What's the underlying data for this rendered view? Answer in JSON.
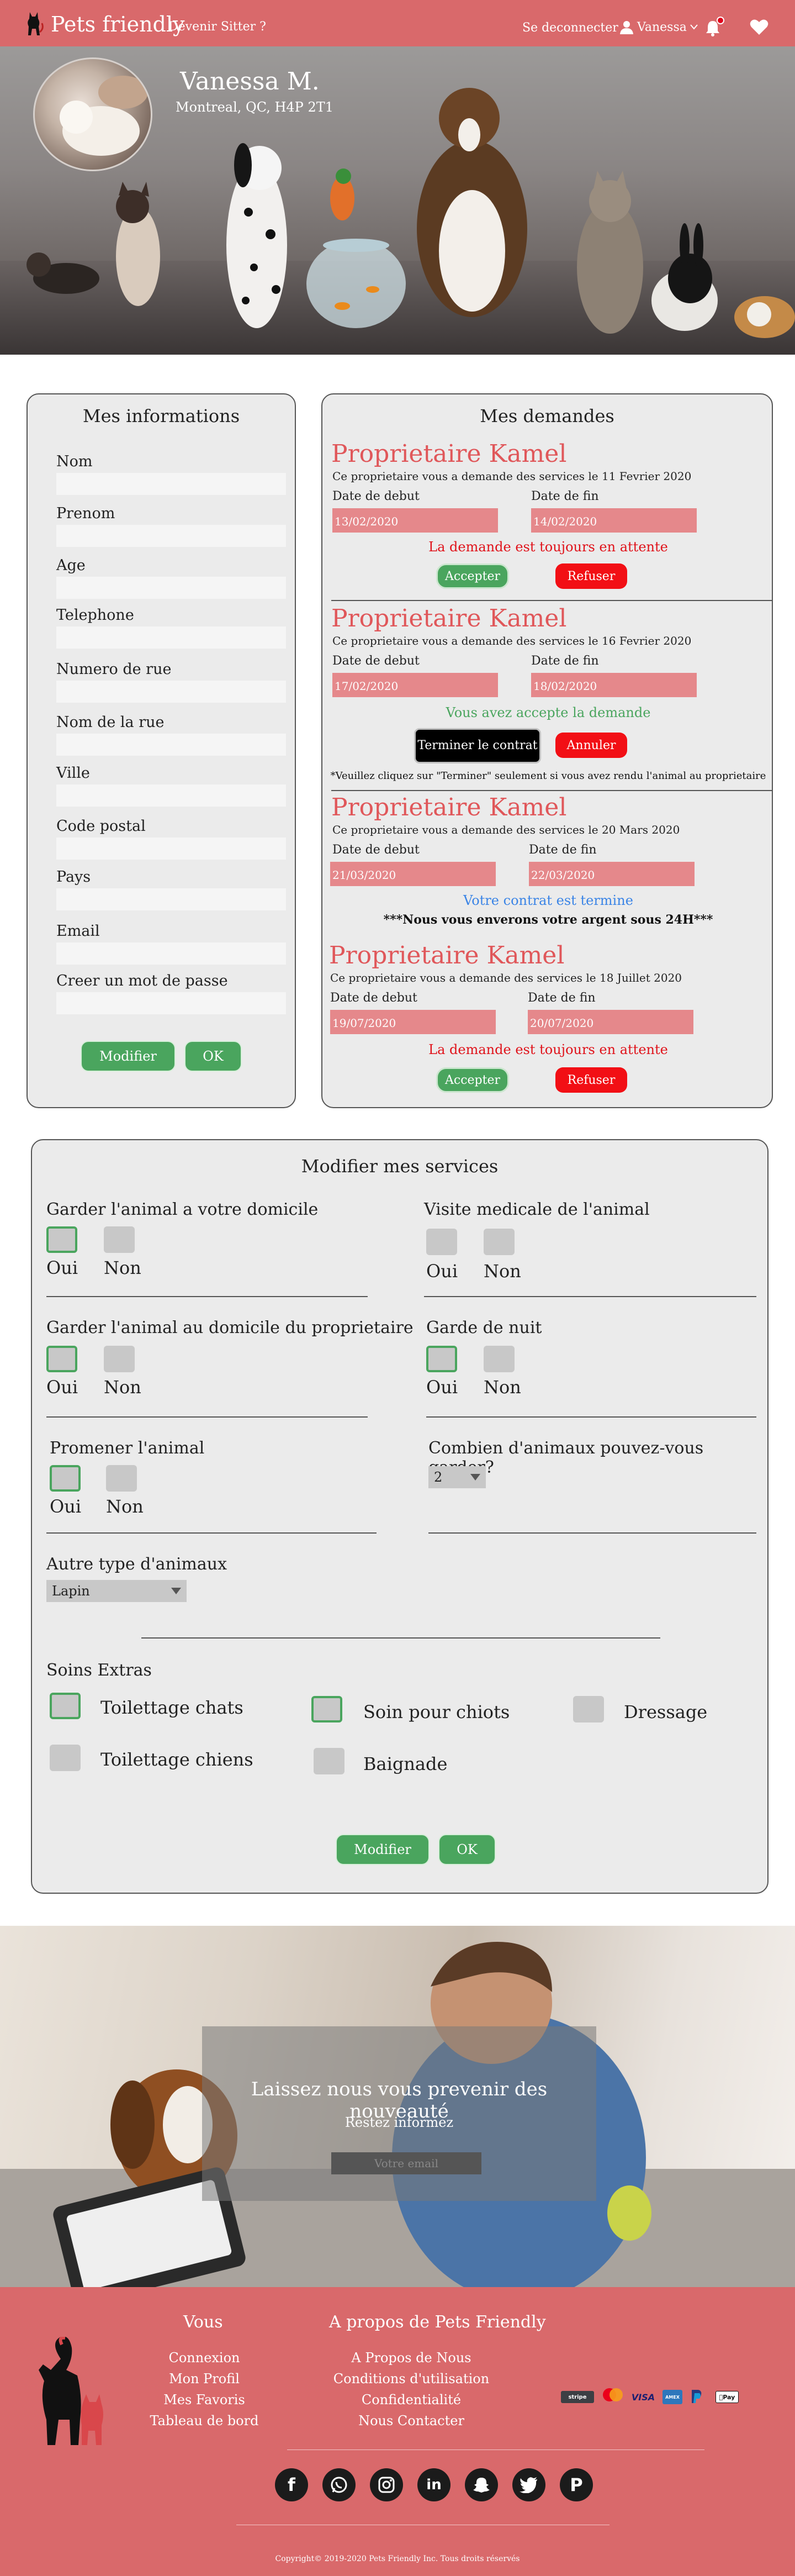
{
  "navbar": {
    "brand": "Pets friendly",
    "become_sitter": "Devenir Sitter ?",
    "logout": "Se deconnecter",
    "user": "Vanessa",
    "colors": {
      "navbar": "#d9696b"
    }
  },
  "profile": {
    "name": "Vanessa M.",
    "address": "Montreal, QC, H4P 2T1"
  },
  "info": {
    "title": "Mes informations",
    "fields": [
      "Nom",
      "Prenom",
      "Age",
      "Telephone",
      "Numero de rue",
      "Nom de la rue",
      "Ville",
      "Code postal",
      "Pays",
      "Email",
      "Creer un mot de passe"
    ],
    "modify_label": "Modifier",
    "ok_label": "OK"
  },
  "requests": {
    "title": "Mes demandes",
    "start_label": "Date de debut",
    "end_label": "Date de fin",
    "items": [
      {
        "owner": "Proprietaire Kamel",
        "text": "Ce proprietaire vous a demande des services le 11 Fevrier 2020",
        "start": "13/02/2020",
        "end": "14/02/2020",
        "status": "La demande est toujours en attente",
        "accept": "Accepter",
        "refuse": "Refuser"
      },
      {
        "owner": "Proprietaire Kamel",
        "text": "Ce proprietaire vous a demande des services le 16 Fevrier 2020",
        "start": "17/02/2020",
        "end": "18/02/2020",
        "status": "Vous avez accepte la demande",
        "finish": "Terminer le contrat",
        "cancel": "Annuler",
        "note": "*Veuillez cliquez sur \"Terminer\" seulement si vous avez rendu l'animal au proprietaire"
      },
      {
        "owner": "Proprietaire Kamel",
        "text": "Ce proprietaire vous a demande des services le 20 Mars 2020",
        "start": "21/03/2020",
        "end": "22/03/2020",
        "status": "Votre contrat est termine",
        "note": "***Nous vous enverons votre argent sous 24H***"
      },
      {
        "owner": "Proprietaire Kamel",
        "text": "Ce proprietaire vous a demande des services le 18 Juillet 2020",
        "start": "19/07/2020",
        "end": "20/07/2020",
        "status": "La demande est toujours en attente",
        "accept": "Accepter",
        "refuse": "Refuser"
      }
    ]
  },
  "services": {
    "title": "Modifier mes services",
    "oui": "Oui",
    "non": "Non",
    "home_care": {
      "label": "Garder l'animal a votre domicile",
      "oui_checked": true
    },
    "vet_visit": {
      "label": "Visite medicale de l'animal",
      "oui_checked": false
    },
    "owner_home": {
      "label": "Garder l'animal au domicile du proprietaire",
      "oui_checked": true
    },
    "night": {
      "label": "Garde de nuit",
      "oui_checked": true
    },
    "walk": {
      "label": "Promener l'animal",
      "oui_checked": true
    },
    "count": {
      "label": "Combien d'animaux pouvez-vous garder?",
      "value": "2"
    },
    "other_animals": {
      "label": "Autre type d'animaux",
      "value": "Lapin"
    },
    "extras_title": "Soins Extras",
    "extras": [
      {
        "label": "Toilettage chats",
        "checked": true
      },
      {
        "label": "Soin pour chiots",
        "checked": true
      },
      {
        "label": "Dressage",
        "checked": false
      },
      {
        "label": "Toilettage chiens",
        "checked": false
      },
      {
        "label": "Baignade",
        "checked": false
      }
    ],
    "modify_label": "Modifier",
    "ok_label": "OK"
  },
  "newsletter": {
    "title": "Laissez nous vous prevenir des nouveauté",
    "subtitle": "Restez informez",
    "placeholder": "Votre email"
  },
  "footer": {
    "vous_title": "Vous",
    "vous_links": [
      "Connexion",
      "Mon Profil",
      "Mes Favoris",
      "Tableau de bord"
    ],
    "about_title": "A propos de Pets Friendly",
    "about_links": [
      "A Propos de Nous",
      "Conditions d'utilisation",
      "Confidentialité",
      "Nous Contacter"
    ],
    "payments": [
      "stripe",
      "mastercard",
      "VISA",
      "AMEX",
      "PayPal",
      "Pay"
    ],
    "socials": [
      "facebook-icon",
      "whatsapp-icon",
      "instagram-icon",
      "linkedin-icon",
      "snapchat-icon",
      "twitter-icon",
      "pinterest-icon"
    ],
    "copyright": "Copyright© 2019-2020 Pets Friendly Inc. Tous droits réservés"
  }
}
